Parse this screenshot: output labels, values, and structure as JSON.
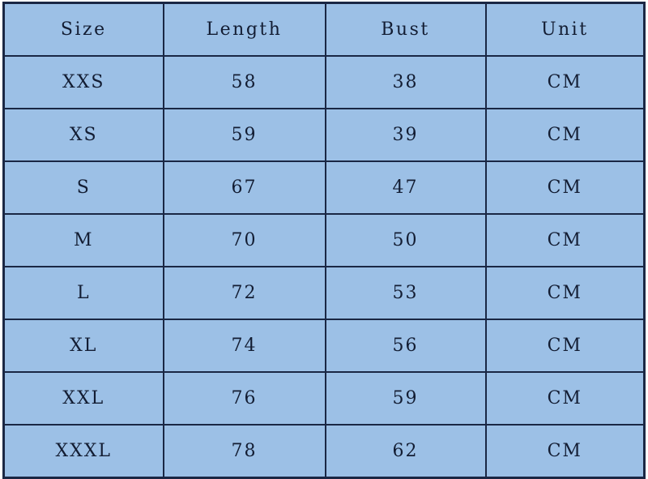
{
  "table": {
    "headers": [
      "Size",
      "Length",
      "Bust",
      "Unit"
    ],
    "rows": [
      {
        "size": "XXS",
        "length": "58",
        "bust": "38",
        "unit": "CM"
      },
      {
        "size": "XS",
        "length": "59",
        "bust": "39",
        "unit": "CM"
      },
      {
        "size": "S",
        "length": "67",
        "bust": "47",
        "unit": "CM"
      },
      {
        "size": "M",
        "length": "70",
        "bust": "50",
        "unit": "CM"
      },
      {
        "size": "L",
        "length": "72",
        "bust": "53",
        "unit": "CM"
      },
      {
        "size": "XL",
        "length": "74",
        "bust": "56",
        "unit": "CM"
      },
      {
        "size": "XXL",
        "length": "76",
        "bust": "59",
        "unit": "CM"
      },
      {
        "size": "XXXL",
        "length": "78",
        "bust": "62",
        "unit": "CM"
      }
    ]
  },
  "colors": {
    "cell_background": "#9cc0e6",
    "border": "#1a2744",
    "text": "#131d33",
    "page_background": "#ffffff"
  }
}
